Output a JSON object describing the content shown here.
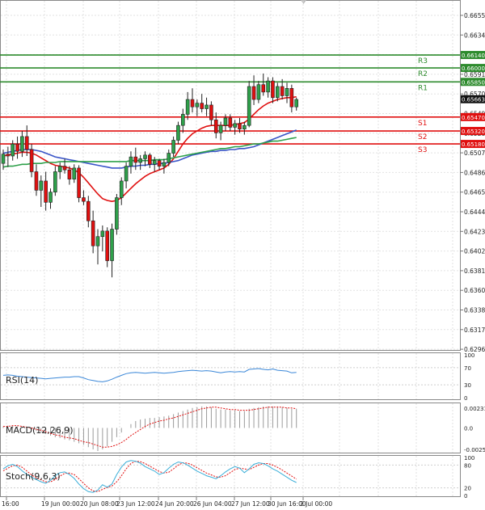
{
  "chart_data": {
    "type": "candlestick",
    "grid": true,
    "x_tick_labels": [
      "16:00",
      "19 Jun 00:00",
      "20 Jun 08:00",
      "23 Jun 12:00",
      "24 Jun 20:00",
      "26 Jun 04:00",
      "27 Jun 12:00",
      "30 Jun 16:00",
      "2 Jul 00:00"
    ],
    "price_panel": {
      "ylim": [
        0.62965,
        0.66655
      ],
      "tick_labels": [
        "0.66550",
        "0.66340",
        "0.66130",
        "0.65915",
        "0.65705",
        "0.65490",
        "0.65280",
        "0.65075",
        "0.64865",
        "0.64650",
        "0.64440",
        "0.64230",
        "0.64020",
        "0.63810",
        "0.63600",
        "0.63385",
        "0.63175",
        "0.62965"
      ],
      "current_price": "0.65663",
      "levels": [
        {
          "name": "R3",
          "value": 0.6614,
          "label": "0.66140",
          "color": "#2e8b2e"
        },
        {
          "name": "R2",
          "value": 0.66,
          "label": "0.66000",
          "color": "#2e8b2e"
        },
        {
          "name": "R1",
          "value": 0.6585,
          "label": "0.65850",
          "color": "#2e8b2e"
        },
        {
          "name": "S1",
          "value": 0.6547,
          "label": "0.65470",
          "color": "#e01010"
        },
        {
          "name": "S2",
          "value": 0.6532,
          "label": "0.65320",
          "color": "#e01010"
        },
        {
          "name": "S3",
          "value": 0.6518,
          "label": "0.65180",
          "color": "#e01010"
        }
      ],
      "candles": [
        [
          0.6497,
          0.6512,
          0.649,
          0.6507
        ],
        [
          0.6507,
          0.6515,
          0.6493,
          0.6505
        ],
        [
          0.6505,
          0.6522,
          0.65,
          0.6518
        ],
        [
          0.6518,
          0.6526,
          0.6502,
          0.651
        ],
        [
          0.651,
          0.6532,
          0.6504,
          0.6526
        ],
        [
          0.6526,
          0.6538,
          0.6505,
          0.6512
        ],
        [
          0.6512,
          0.6518,
          0.6482,
          0.6488
        ],
        [
          0.6488,
          0.6496,
          0.6462,
          0.6468
        ],
        [
          0.6468,
          0.6484,
          0.645,
          0.6478
        ],
        [
          0.6478,
          0.6488,
          0.6446,
          0.6455
        ],
        [
          0.6455,
          0.647,
          0.6448,
          0.6466
        ],
        [
          0.6466,
          0.6494,
          0.6462,
          0.6488
        ],
        [
          0.6488,
          0.6498,
          0.648,
          0.6494
        ],
        [
          0.6494,
          0.6502,
          0.6486,
          0.649
        ],
        [
          0.649,
          0.6494,
          0.6474,
          0.648
        ],
        [
          0.648,
          0.6496,
          0.6476,
          0.6492
        ],
        [
          0.6492,
          0.6495,
          0.6455,
          0.646
        ],
        [
          0.646,
          0.6468,
          0.6452,
          0.6456
        ],
        [
          0.6456,
          0.6462,
          0.6428,
          0.6435
        ],
        [
          0.6435,
          0.6446,
          0.64,
          0.6408
        ],
        [
          0.6408,
          0.6426,
          0.6388,
          0.6418
        ],
        [
          0.6418,
          0.643,
          0.6402,
          0.6424
        ],
        [
          0.6424,
          0.6428,
          0.6385,
          0.6392
        ],
        [
          0.6392,
          0.6432,
          0.6374,
          0.6426
        ],
        [
          0.6426,
          0.6464,
          0.642,
          0.646
        ],
        [
          0.646,
          0.6482,
          0.6452,
          0.6478
        ],
        [
          0.6478,
          0.6498,
          0.647,
          0.6494
        ],
        [
          0.6494,
          0.651,
          0.6486,
          0.6504
        ],
        [
          0.6504,
          0.6514,
          0.649,
          0.6498
        ],
        [
          0.6498,
          0.6506,
          0.649,
          0.6502
        ],
        [
          0.6502,
          0.651,
          0.6494,
          0.6506
        ],
        [
          0.6506,
          0.6508,
          0.6492,
          0.6496
        ],
        [
          0.6496,
          0.6504,
          0.6488,
          0.65
        ],
        [
          0.65,
          0.6502,
          0.649,
          0.6494
        ],
        [
          0.6494,
          0.6502,
          0.6486,
          0.6498
        ],
        [
          0.6498,
          0.6512,
          0.6494,
          0.6508
        ],
        [
          0.6508,
          0.6526,
          0.6504,
          0.6522
        ],
        [
          0.6522,
          0.6542,
          0.6518,
          0.6538
        ],
        [
          0.6538,
          0.6556,
          0.653,
          0.655
        ],
        [
          0.655,
          0.6574,
          0.6544,
          0.6566
        ],
        [
          0.6566,
          0.6578,
          0.6552,
          0.6558
        ],
        [
          0.6558,
          0.6566,
          0.6548,
          0.6562
        ],
        [
          0.6562,
          0.6572,
          0.6552,
          0.6556
        ],
        [
          0.6556,
          0.6568,
          0.6548,
          0.656
        ],
        [
          0.656,
          0.6564,
          0.6538,
          0.6544
        ],
        [
          0.6544,
          0.6552,
          0.6524,
          0.653
        ],
        [
          0.653,
          0.6542,
          0.6522,
          0.6538
        ],
        [
          0.6538,
          0.655,
          0.6532,
          0.6546
        ],
        [
          0.6546,
          0.655,
          0.6532,
          0.6536
        ],
        [
          0.6536,
          0.6544,
          0.6528,
          0.654
        ],
        [
          0.654,
          0.6546,
          0.653,
          0.6534
        ],
        [
          0.6534,
          0.6542,
          0.6528,
          0.6538
        ],
        [
          0.6538,
          0.6586,
          0.6536,
          0.658
        ],
        [
          0.658,
          0.6592,
          0.656,
          0.6566
        ],
        [
          0.6566,
          0.6586,
          0.6562,
          0.6582
        ],
        [
          0.6582,
          0.6594,
          0.657,
          0.6574
        ],
        [
          0.6574,
          0.659,
          0.6568,
          0.6586
        ],
        [
          0.6586,
          0.659,
          0.6562,
          0.6568
        ],
        [
          0.6568,
          0.6584,
          0.6564,
          0.658
        ],
        [
          0.658,
          0.6588,
          0.6566,
          0.657
        ],
        [
          0.657,
          0.6584,
          0.6562,
          0.6578
        ],
        [
          0.6578,
          0.6582,
          0.6552,
          0.6558
        ],
        [
          0.6558,
          0.6568,
          0.6554,
          0.6566
        ]
      ],
      "moving_averages": [
        {
          "color": "#e01010",
          "values": [
            0.6505,
            0.6506,
            0.6507,
            0.6508,
            0.6509,
            0.6509,
            0.6508,
            0.6506,
            0.6503,
            0.65,
            0.6497,
            0.6495,
            0.6494,
            0.6493,
            0.6492,
            0.649,
            0.6487,
            0.6482,
            0.6476,
            0.647,
            0.6464,
            0.6459,
            0.6457,
            0.6456,
            0.6457,
            0.646,
            0.6465,
            0.647,
            0.6475,
            0.6479,
            0.6483,
            0.6486,
            0.6488,
            0.649,
            0.6492,
            0.6496,
            0.6502,
            0.651,
            0.6518,
            0.6524,
            0.6529,
            0.6532,
            0.6535,
            0.6537,
            0.6538,
            0.6538,
            0.6538,
            0.6538,
            0.6538,
            0.6539,
            0.654,
            0.6541,
            0.6545,
            0.655,
            0.6555,
            0.6559,
            0.6562,
            0.6564,
            0.6566,
            0.6567,
            0.6568,
            0.6568,
            0.6569
          ]
        },
        {
          "color": "#3a55c8",
          "values": [
            0.6508,
            0.6509,
            0.651,
            0.6511,
            0.6512,
            0.6512,
            0.6512,
            0.6511,
            0.651,
            0.6508,
            0.6506,
            0.6504,
            0.6503,
            0.6502,
            0.6501,
            0.65,
            0.6499,
            0.6498,
            0.6497,
            0.6496,
            0.6495,
            0.6494,
            0.6493,
            0.6492,
            0.6492,
            0.6492,
            0.6493,
            0.6494,
            0.6494,
            0.6495,
            0.6495,
            0.6496,
            0.6496,
            0.6497,
            0.6497,
            0.6498,
            0.6499,
            0.65,
            0.6502,
            0.6504,
            0.6506,
            0.6507,
            0.6508,
            0.6509,
            0.651,
            0.651,
            0.6511,
            0.6511,
            0.6512,
            0.6512,
            0.6513,
            0.6513,
            0.6514,
            0.6515,
            0.6517,
            0.6519,
            0.6521,
            0.6523,
            0.6525,
            0.6527,
            0.6529,
            0.6531,
            0.6533
          ]
        },
        {
          "color": "#2ea04a",
          "values": [
            0.6493,
            0.6494,
            0.6494,
            0.6495,
            0.6496,
            0.6496,
            0.6497,
            0.6497,
            0.6497,
            0.6498,
            0.6498,
            0.6498,
            0.6499,
            0.6499,
            0.6499,
            0.6499,
            0.6499,
            0.6499,
            0.6499,
            0.6499,
            0.6499,
            0.6499,
            0.6499,
            0.6499,
            0.6499,
            0.6499,
            0.6499,
            0.65,
            0.65,
            0.65,
            0.65,
            0.65,
            0.6501,
            0.6501,
            0.6501,
            0.6502,
            0.6503,
            0.6504,
            0.6505,
            0.6506,
            0.6507,
            0.6508,
            0.6509,
            0.651,
            0.6511,
            0.6512,
            0.6513,
            0.6513,
            0.6514,
            0.6515,
            0.6515,
            0.6516,
            0.6517,
            0.6518,
            0.6518,
            0.6519,
            0.652,
            0.6521,
            0.6521,
            0.6522,
            0.6523,
            0.6524,
            0.6525
          ]
        }
      ]
    },
    "rsi_panel": {
      "label": "RSI(14)",
      "ylim": [
        0,
        100
      ],
      "tick_labels": [
        "100",
        "70",
        "30",
        "0"
      ],
      "color": "#3a87d8",
      "values": [
        52,
        53,
        52,
        50,
        49,
        48,
        47,
        46,
        45,
        44,
        45,
        46,
        47,
        48,
        48,
        49,
        49,
        46,
        42,
        40,
        38,
        37,
        39,
        43,
        48,
        52,
        56,
        58,
        59,
        58,
        57,
        58,
        59,
        58,
        57,
        58,
        59,
        61,
        62,
        63,
        64,
        63,
        62,
        63,
        62,
        60,
        58,
        60,
        61,
        60,
        61,
        60,
        66,
        67,
        68,
        66,
        65,
        67,
        64,
        63,
        62,
        58,
        59
      ]
    },
    "macd_panel": {
      "label": "MACD(12,26,9)",
      "tick_labels": [
        "0.002319",
        "0.0",
        "-0.00250"
      ],
      "ylim": [
        -0.0028,
        0.0027
      ],
      "histogram": [
        2e-05,
        3e-05,
        3e-05,
        2e-05,
        1e-05,
        0.0,
        -2e-05,
        -4e-05,
        -6e-05,
        -8e-05,
        -0.0001,
        -0.00012,
        -0.00013,
        -0.00015,
        -0.00016,
        -0.00018,
        -0.0002,
        -0.00022,
        -0.00025,
        -0.00028,
        -0.0003,
        -0.00028,
        -0.00024,
        -0.00018,
        -0.00012,
        -6e-05,
        0.0,
        5e-05,
        9e-05,
        0.00011,
        0.00012,
        0.00013,
        0.00013,
        0.00014,
        0.00015,
        0.00016,
        0.00018,
        0.0002,
        0.00022,
        0.00024,
        0.00026,
        0.00027,
        0.00028,
        0.00028,
        0.00027,
        0.00025,
        0.00024,
        0.00024,
        0.00023,
        0.00023,
        0.00022,
        0.00022,
        0.00025,
        0.00026,
        0.00027,
        0.00028,
        0.00028,
        0.00028,
        0.00028,
        0.00027,
        0.00026,
        0.00025,
        0.00025
      ],
      "signal": [
        2e-05,
        2e-05,
        3e-05,
        3e-05,
        2e-05,
        1e-05,
        0.0,
        -2e-05,
        -3e-05,
        -5e-05,
        -7e-05,
        -9e-05,
        -0.0001,
        -0.00012,
        -0.00013,
        -0.00014,
        -0.00016,
        -0.00018,
        -0.00019,
        -0.00021,
        -0.00023,
        -0.00025,
        -0.00025,
        -0.00024,
        -0.00022,
        -0.00019,
        -0.00015,
        -0.0001,
        -6e-05,
        -2e-05,
        2e-05,
        5e-05,
        7e-05,
        9e-05,
        0.0001,
        0.00012,
        0.00013,
        0.00015,
        0.00017,
        0.00019,
        0.00021,
        0.00023,
        0.00025,
        0.00026,
        0.00027,
        0.00027,
        0.00026,
        0.00025,
        0.00024,
        0.00024,
        0.00023,
        0.00023,
        0.00023,
        0.00024,
        0.00025,
        0.00026,
        0.00027,
        0.00027,
        0.00027,
        0.00027,
        0.00026,
        0.00026,
        0.00025
      ],
      "hist_color": "#9a9a9a",
      "signal_color": "#e01010"
    },
    "stoch_panel": {
      "label": "Stoch(9,6,3)",
      "ylim": [
        0,
        100
      ],
      "tick_labels": [
        "100",
        "80",
        "20",
        "0"
      ],
      "main_color": "#3aaed8",
      "signal_color": "#e01010",
      "main": [
        70,
        78,
        82,
        76,
        65,
        55,
        48,
        42,
        36,
        32,
        40,
        52,
        60,
        62,
        55,
        45,
        30,
        18,
        10,
        8,
        14,
        28,
        22,
        30,
        55,
        75,
        88,
        92,
        90,
        85,
        76,
        70,
        64,
        55,
        60,
        72,
        82,
        88,
        86,
        80,
        72,
        64,
        58,
        52,
        48,
        44,
        52,
        62,
        70,
        76,
        72,
        60,
        70,
        82,
        86,
        84,
        78,
        70,
        64,
        56,
        48,
        40,
        34
      ],
      "signal": [
        65,
        72,
        78,
        80,
        74,
        64,
        54,
        47,
        41,
        36,
        36,
        42,
        51,
        58,
        59,
        55,
        44,
        32,
        20,
        12,
        10,
        16,
        21,
        25,
        36,
        52,
        70,
        84,
        90,
        89,
        84,
        77,
        70,
        63,
        59,
        61,
        70,
        80,
        86,
        85,
        80,
        73,
        66,
        59,
        54,
        49,
        48,
        52,
        60,
        68,
        72,
        70,
        68,
        74,
        80,
        84,
        84,
        80,
        74,
        67,
        59,
        51,
        43
      ]
    }
  }
}
